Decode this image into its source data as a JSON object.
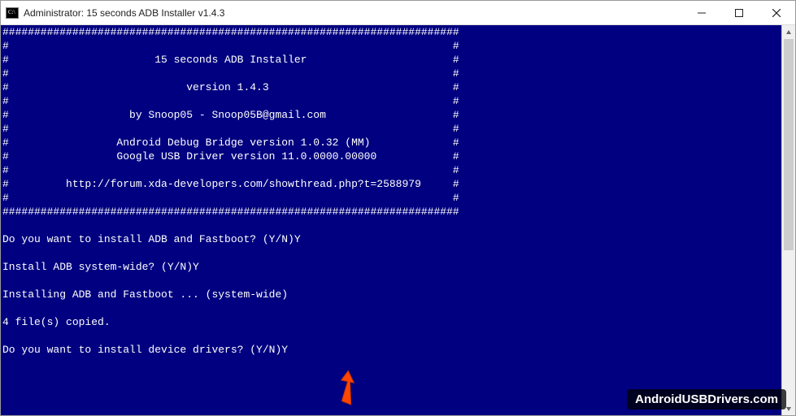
{
  "window": {
    "title": "Administrator:  15 seconds ADB Installer v1.4.3"
  },
  "terminal": {
    "hashline": "########################################################################",
    "hashedge_left": "#",
    "hashedge_right": "#",
    "banner_title": "15 seconds ADB Installer",
    "banner_version": "version 1.4.3",
    "banner_by": "by Snoop05 - Snoop05B@gmail.com",
    "banner_adb_version": "Android Debug Bridge version 1.0.32 (MM)",
    "banner_driver_version": "Google USB Driver version 11.0.0000.00000",
    "banner_url": "http://forum.xda-developers.com/showthread.php?t=2588979",
    "prompt1": "Do you want to install ADB and Fastboot? (Y/N)",
    "answer1": "Y",
    "prompt2": "Install ADB system-wide? (Y/N)",
    "answer2": "Y",
    "status1": "Installing ADB and Fastboot ... (system-wide)",
    "status2": "4 file(s) copied.",
    "prompt3": "Do you want to install device drivers? (Y/N)",
    "answer3": "Y"
  },
  "watermark": "AndroidUSBDrivers.com"
}
